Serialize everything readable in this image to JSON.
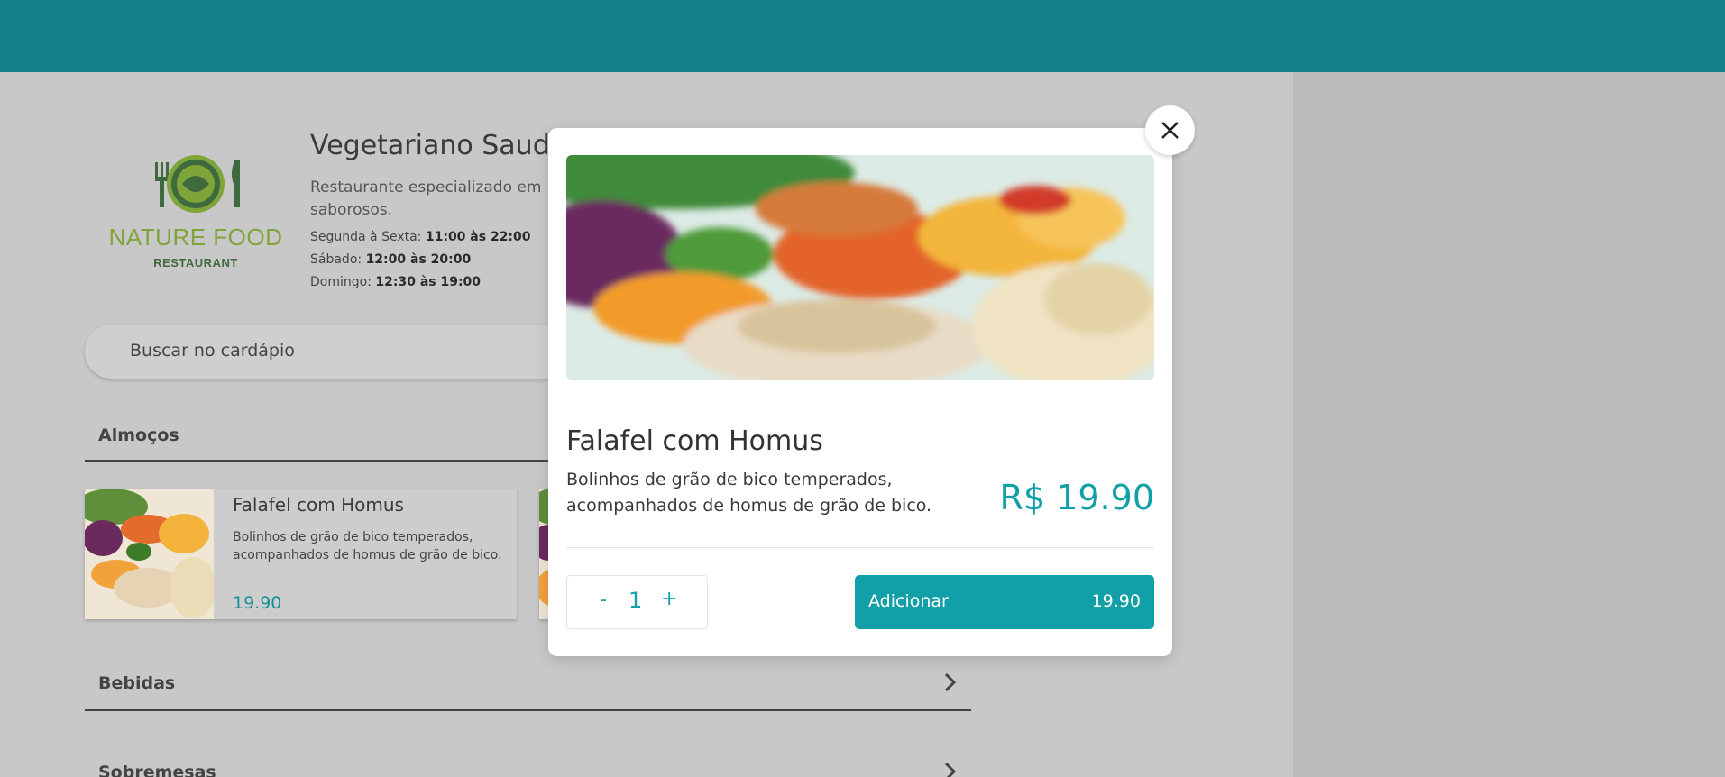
{
  "restaurant": {
    "logo_main": "NATURE FOOD",
    "logo_sub": "RESTAURANT",
    "name": "Vegetariano Saud",
    "description": "Restaurante especializado em saborosos.",
    "hours": [
      {
        "day": "Segunda à Sexta:",
        "time": "11:00 às 22:00"
      },
      {
        "day": "Sábado:",
        "time": "12:00 às 20:00"
      },
      {
        "day": "Domingo:",
        "time": "12:30 às 19:00"
      }
    ]
  },
  "search": {
    "placeholder": "Buscar no cardápio"
  },
  "sections": [
    {
      "label": "Almoços"
    },
    {
      "label": "Bebidas"
    },
    {
      "label": "Sobremesas"
    }
  ],
  "card": {
    "title": "Falafel com Homus",
    "description": "Bolinhos de grão de bico temperados, acompanhados de homus de grão de bico.",
    "price": "19.90"
  },
  "modal": {
    "title": "Falafel com Homus",
    "description": "Bolinhos de grão de bico temperados, acompanhados de homus de grão de bico.",
    "price": "R$ 19.90",
    "quantity": "1",
    "minus": "-",
    "plus": "+",
    "add_label": "Adicionar",
    "add_total": "19.90"
  },
  "icons": {
    "close": "close-icon",
    "chevron": "chevron-right-icon",
    "fork": "fork-icon",
    "knife": "knife-icon"
  },
  "colors": {
    "topbar": "#148189",
    "accent": "#12a0a8",
    "logo_green": "#7ea43a"
  }
}
